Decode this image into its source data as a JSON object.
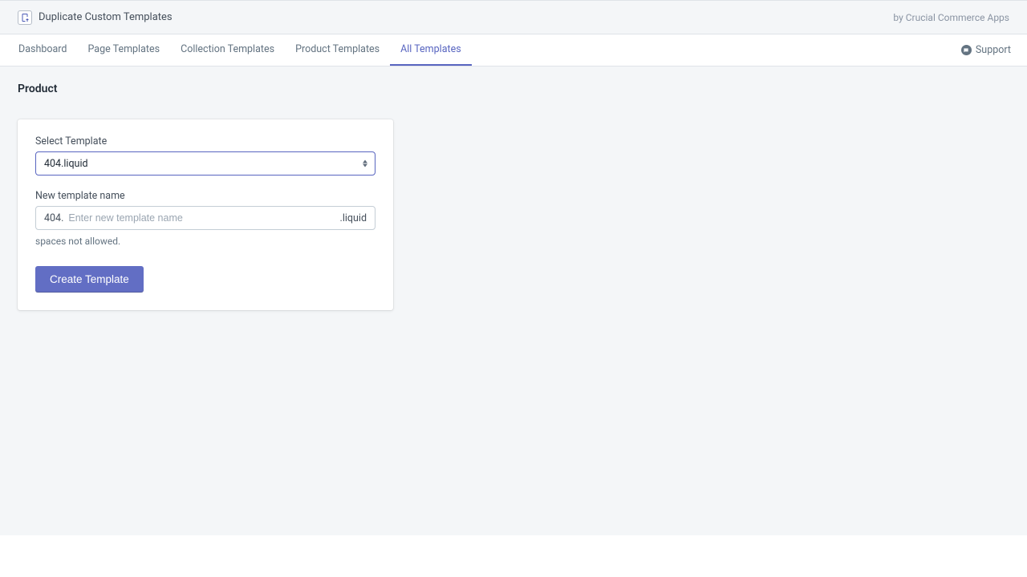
{
  "header": {
    "app_title": "Duplicate Custom Templates",
    "byline": "by Crucial Commerce Apps"
  },
  "tabs": {
    "dashboard": "Dashboard",
    "page_templates": "Page Templates",
    "collection_templates": "Collection Templates",
    "product_templates": "Product Templates",
    "all_templates": "All Templates"
  },
  "support_label": "Support",
  "page": {
    "section_title": "Product"
  },
  "form": {
    "select_label": "Select Template",
    "select_value": "404.liquid",
    "name_label": "New template name",
    "name_prefix": "404.",
    "name_placeholder": "Enter new template name",
    "name_suffix": ".liquid",
    "helper": "spaces not allowed.",
    "submit_label": "Create Template"
  }
}
